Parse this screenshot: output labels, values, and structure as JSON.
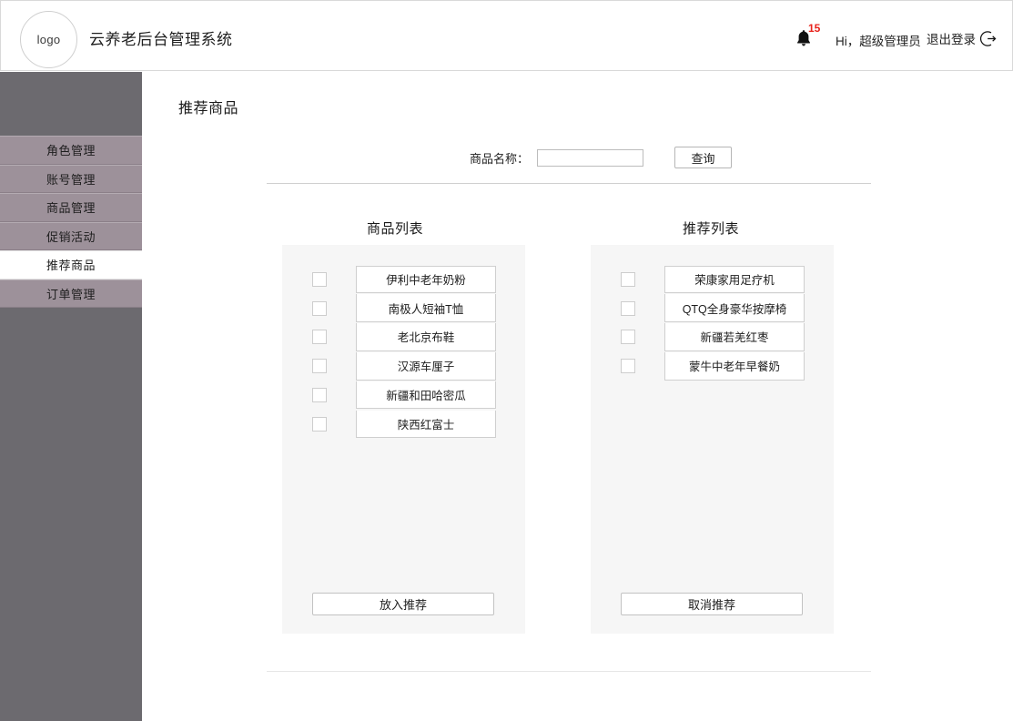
{
  "header": {
    "logo_text": "logo",
    "app_title": "云养老后台管理系统",
    "bell_icon": "bell-icon",
    "notification_count": "15",
    "greeting": "Hi，超级管理员",
    "logout_label": "退出登录",
    "logout_icon": "logout-icon"
  },
  "sidebar": {
    "items": [
      {
        "label": "角色管理",
        "active": false
      },
      {
        "label": "账号管理",
        "active": false
      },
      {
        "label": "商品管理",
        "active": false
      },
      {
        "label": "促销活动",
        "active": false
      },
      {
        "label": "推荐商品",
        "active": true
      },
      {
        "label": "订单管理",
        "active": false
      }
    ]
  },
  "main": {
    "page_title": "推荐商品",
    "search": {
      "label": "商品名称：",
      "value": "",
      "placeholder": "",
      "button_label": "查询"
    },
    "product_panel": {
      "title": "商品列表",
      "items": [
        {
          "label": "伊利中老年奶粉",
          "checked": false
        },
        {
          "label": "南极人短袖T恤",
          "checked": false
        },
        {
          "label": "老北京布鞋",
          "checked": false
        },
        {
          "label": "汉源车厘子",
          "checked": false
        },
        {
          "label": "新疆和田哈密瓜",
          "checked": false
        },
        {
          "label": "陕西红富士",
          "checked": false
        }
      ],
      "action_label": "放入推荐"
    },
    "recommend_panel": {
      "title": "推荐列表",
      "items": [
        {
          "label": "荣康家用足疗机",
          "checked": false
        },
        {
          "label": "QTQ全身豪华按摩椅",
          "checked": false
        },
        {
          "label": "新疆若羌红枣",
          "checked": false
        },
        {
          "label": "蒙牛中老年早餐奶",
          "checked": false
        }
      ],
      "action_label": "取消推荐"
    }
  },
  "colors": {
    "sidebar_bg": "#6c6a6f",
    "sidebar_item_bg": "#9d919a",
    "sidebar_item_active_bg": "#ffffff",
    "panel_bg": "#f6f6f6",
    "badge_red": "#e8231c",
    "border": "#cfcfcf"
  }
}
